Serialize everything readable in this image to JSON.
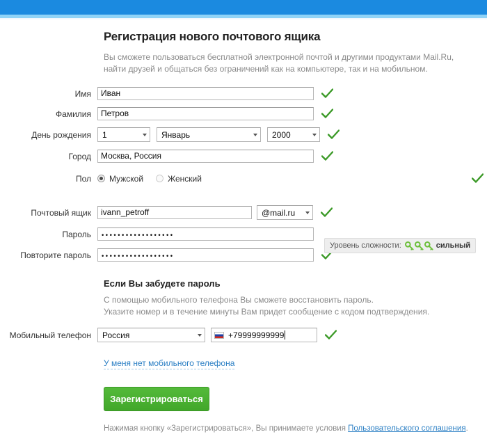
{
  "theme": {
    "top_bar_color": "#1b8ae0",
    "top_bar_accent": "#8fd3f7",
    "check_color": "#3c9a28",
    "button_color": "#4bb132",
    "link_color": "#2b7fc4"
  },
  "header": {
    "title": "Регистрация нового почтового ящика",
    "intro_line1": "Вы сможете пользоваться бесплатной электронной почтой и другими продуктами Mail.Ru,",
    "intro_line2": "найти друзей и общаться без ограничений как на компьютере, так и на мобильном."
  },
  "form": {
    "first_name": {
      "label": "Имя",
      "value": "Иван",
      "placeholder": ""
    },
    "last_name": {
      "label": "Фамилия",
      "value": "Петров",
      "placeholder": ""
    },
    "birthday": {
      "label": "День рождения",
      "day": "1",
      "month": "Январь",
      "year": "2000"
    },
    "city": {
      "label": "Город",
      "value": "Москва, Россия",
      "placeholder": ""
    },
    "gender": {
      "label": "Пол",
      "male_label": "Мужской",
      "female_label": "Женский",
      "selected": "Мужской"
    },
    "mailbox": {
      "label": "Почтовый ящик",
      "value": "ivann_petroff",
      "domain": "@mail.ru"
    },
    "password": {
      "label": "Пароль",
      "masked_value": "••••••••••••••••••"
    },
    "password_repeat": {
      "label": "Повторите пароль",
      "masked_value": "••••••••••••••••••"
    },
    "strength": {
      "label": "Уровень сложности:",
      "verdict": "сильный",
      "keys": 3
    }
  },
  "forgot": {
    "title": "Если Вы забудете пароль",
    "line1": "С помощью мобильного телефона Вы сможете восстановить пароль.",
    "line2": "Указите номер и в течение минуты Вам придет сообщение с кодом подтверждения.",
    "phone_label": "Мобильный телефон",
    "country": "Россия",
    "phone_value": "+79999999999",
    "no_phone_link": "У меня нет мобильного телефона"
  },
  "footer": {
    "submit_label": "Зарегистрироваться",
    "terms_prefix": "Нажимая кнопку «Зарегистрироваться», Вы принимаете условия ",
    "terms_link": "Пользовательского соглашения",
    "terms_suffix": "."
  },
  "icons": {
    "check": "check-icon",
    "caret": "chevron-down-icon",
    "key": "key-icon",
    "flag": "russia-flag-icon"
  }
}
